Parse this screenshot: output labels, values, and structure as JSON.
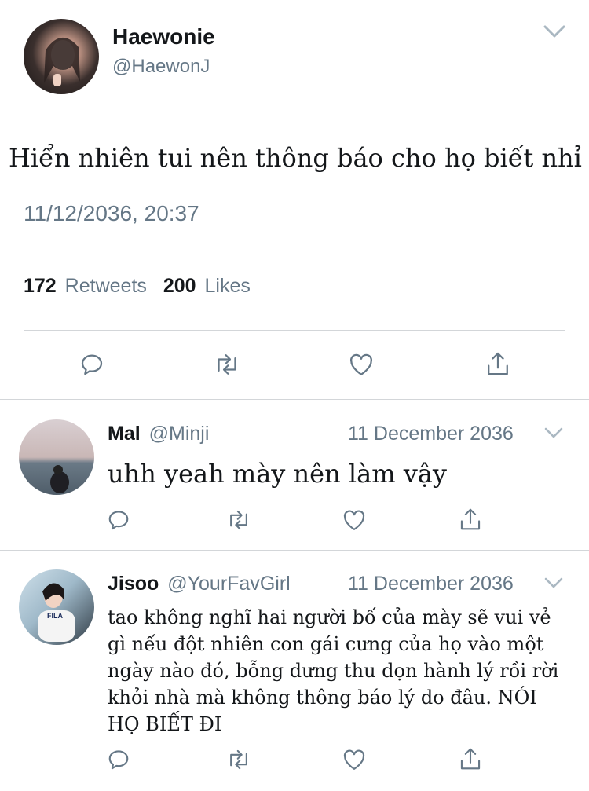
{
  "main_tweet": {
    "display_name": "Haewonie",
    "handle": "@HaewonJ",
    "text": "Hiển nhiên tui nên thông báo cho họ biết nhỉ",
    "timestamp": "11/12/2036, 20:37",
    "retweets_count": "172",
    "retweets_label": "Retweets",
    "likes_count": "200",
    "likes_label": "Likes"
  },
  "replies": [
    {
      "display_name": "Mal",
      "handle": "@Minji",
      "date": "11 December 2036",
      "text": "uhh yeah mày nên làm vậy"
    },
    {
      "display_name": "Jisoo",
      "handle": "@YourFavGirl",
      "date": "11 December 2036",
      "text": "tao không nghĩ hai người bố của mày sẽ vui vẻ gì nếu đột nhiên con gái cưng của họ vào một ngày nào đó, bỗng dưng thu dọn hành lý rồi rời khỏi nhà mà không thông báo lý do đâu. NÓI HỌ BIẾT ĐI",
      "avatar_text": "FILA"
    }
  ],
  "colors": {
    "icon_gray": "#657786",
    "divider": "#d3d6d9",
    "text": "#14171a"
  }
}
